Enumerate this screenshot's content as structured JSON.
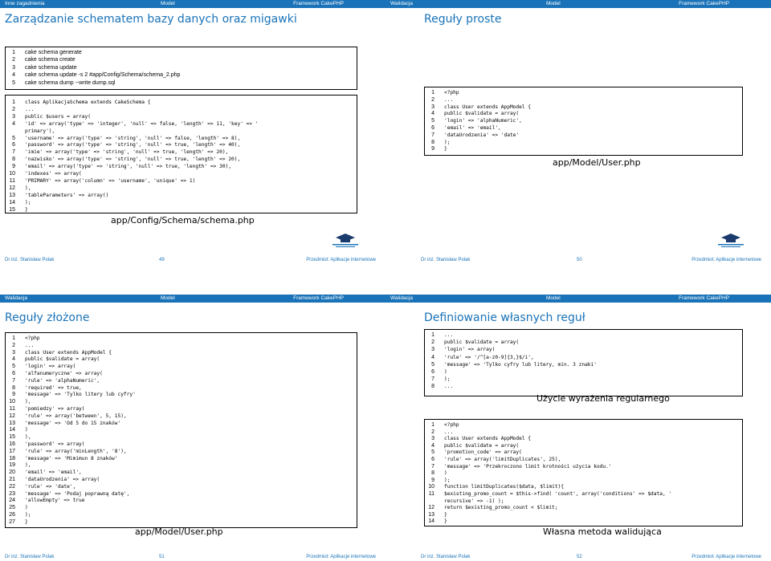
{
  "slides": [
    {
      "header": {
        "left": "Inne zagadnienia",
        "middle": "Model",
        "right": "Framework CakePHP"
      },
      "title": "Zarządzanie schematem bazy danych oraz migawki",
      "footer": {
        "author": "Dr inż. Stanisław Polak",
        "page": "49",
        "course": "Przedmiot: Aplikacje internetowe"
      },
      "box1": [
        "cake schema generate",
        "cake schema create",
        "cake schema update",
        "cake schema update -s 2 #app/Config/Schema/schema_2.php",
        "cake schema dump --write dump.sql"
      ],
      "box2": [
        "class AplikacjaSchema extends CakeSchema {",
        " ...",
        "  public $users = array(",
        "   'id' => array('type' => 'integer', 'null' => false, 'length' => 11, 'key' => '",
        "       primary'),",
        "   'username' => array('type' => 'string', 'null' => false, 'length' => 8),",
        "   'password' => array('type' => 'string', 'null' => true, 'length' => 40),",
        "   'imie' => array('type' => 'string', 'null' => true, 'length' => 20),",
        "   'nazwisko' => array('type' => 'string', 'null' => true, 'length' => 20),",
        "   'email' => array('type' => 'string', 'null' => true, 'length' => 30),",
        "   'indexes' => array(",
        "     'PRIMARY' => array('column' => 'username', 'unique' => 1)",
        "   ),",
        "   'tableParameters' => array()",
        "  );",
        "}"
      ],
      "box2_numbers": [
        "1",
        "2",
        "3",
        "4",
        "",
        "5",
        "6",
        "7",
        "8",
        "9",
        "10",
        "11",
        "12",
        "13",
        "14",
        "15"
      ],
      "caption": "app/Config/Schema/schema.php"
    },
    {
      "header": {
        "left": "Walidacja",
        "middle": "Model",
        "right": "Framework CakePHP"
      },
      "title": "Reguły proste",
      "footer": {
        "author": "Dr inż. Stanisław Polak",
        "page": "50",
        "course": "Przedmiot: Aplikacje internetowe"
      },
      "box1": [
        "<?php",
        "...",
        "class User extends AppModel {",
        "  public $validate = array(",
        "    'login' => 'alphaNumeric',",
        "    'email' => 'email',",
        "    'dataUrodzenia' => 'date'",
        "  );",
        "}"
      ],
      "caption": "app/Model/User.php"
    },
    {
      "header": {
        "left": "Walidacja",
        "middle": "Model",
        "right": "Framework CakePHP"
      },
      "title": "Reguły złożone",
      "footer": {
        "author": "Dr inż. Stanisław Polak",
        "page": "51",
        "course": "Przedmiot: Aplikacje internetowe"
      },
      "box1": [
        "<?php",
        "...",
        "class User extends AppModel {",
        "  public $validate = array(",
        "    'login' => array(",
        "      'alfanumeryczne' => array(",
        "        'rule' => 'alphaNumeric',",
        "        'required' => true,",
        "        'message' => 'Tylko litery lub cyfry'",
        "      ),",
        "      'pomiedzy' => array(",
        "        'rule' => array('between', 5, 15),",
        "        'message' => 'Od 5 do 15 znaków'",
        "      )",
        "    ),",
        "    'password' => array(",
        "      'rule' => array('minLength', '8'),",
        "      'message' => 'Mimimun 8 znaków'",
        "    ),",
        "    'email' => 'email',",
        "    'dataUrodzenia' => array(",
        "      'rule' => 'date',",
        "      'message' => 'Podaj poprawną datę',",
        "      'allowEmpty' => true",
        "    )",
        "  );",
        "}"
      ],
      "caption": "app/Model/User.php"
    },
    {
      "header": {
        "left": "Walidacja",
        "middle": "Model",
        "right": "Framework CakePHP"
      },
      "title": "Definiowanie własnych reguł",
      "footer": {
        "author": "Dr inż. Stanisław Polak",
        "page": "52",
        "course": "Przedmiot: Aplikacje internetowe"
      },
      "box1": [
        "...",
        "public $validate = array(",
        "  'login' => array(",
        "    'rule' => '/^[a-z0-9]{3,}$/i',",
        "    'message' => 'Tylko cyfry lub litery, min. 3 znaki'",
        "  )",
        ");",
        "..."
      ],
      "caption1": "Użycie wyrażenia regularnego",
      "box2": [
        "<?php",
        "...",
        "class User extends AppModel {",
        "  public $validate = array(",
        "    'promotion_code' => array(",
        "      'rule' => array('limitDuplicates', 25),",
        "      'message' => 'Przekroczono limit krotności użycia kodu.'",
        "    )",
        "  );",
        "  function limitDuplicates($data, $limit){",
        "    $existing_promo_count = $this->find( 'count', array('conditions' => $data, '",
        "        recursive' => -1) );",
        "    return $existing_promo_count < $limit;",
        "  }",
        "}"
      ],
      "box2_numbers": [
        "1",
        "2",
        "3",
        "4",
        "5",
        "6",
        "7",
        "8",
        "9",
        "10",
        "11",
        "",
        "12",
        "13",
        "14"
      ],
      "caption2": "Własna metoda walidująca"
    }
  ],
  "colors": {
    "accent": "#1a73b8"
  },
  "icons": [
    "university-logo-icon"
  ]
}
